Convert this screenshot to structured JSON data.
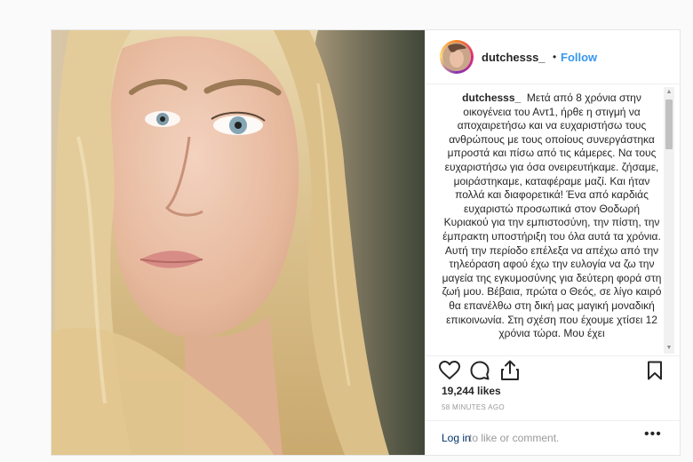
{
  "post": {
    "username": "dutchesss_",
    "separator": "•",
    "follow_label": "Follow",
    "caption_username": "dutchesss_",
    "caption_text": "Μετά από 8 χρόνια στην οικογένεια του Αντ1, ήρθε η στιγμή να αποχαιρετήσω και να ευχαριστήσω τους ανθρώπους με τους οποίους συνεργάστηκα μπροστά και πίσω από τις κάμερες. Να τους ευχαριστήσω για όσα ονειρευτήκαμε. ζήσαμε, μοιράστηκαμε, καταφέραμε μαζί. Και ήταν πολλά και διαφορετικά! Ένα από καρδιάς ευχαριστώ προσωπικά στον Θοδωρή Κυριακού για την εμπιστοσύνη, την πίστη, την έμπρακτη υποστήριξη του όλα αυτά τα χρόνια. Αυτή την περίοδο επέλεξα να απέχω από την τηλεόραση αφού έχω την ευλογία να ζω την μαγεία της εγκυμοσύνης για δεύτερη φορά στη ζωή μου. Βέβαια, πρώτα ο Θεός, σε λίγο καιρό θα επανέλθω στη δική μας μαγική μοναδική επικοινωνία. Στη σχέση που έχουμε χτίσει 12 χρόνια τώρα. Μου έχει",
    "likes": "19,244 likes",
    "timestamp": "58 MINUTES AGO",
    "login_link": "Log in",
    "login_rest": "to like or comment.",
    "more_label": "•••"
  },
  "icons": {
    "like": "heart-icon",
    "comment": "comment-icon",
    "share": "share-icon",
    "save": "bookmark-icon"
  },
  "colors": {
    "link_blue": "#3897f0",
    "text": "#262626",
    "muted": "#999999",
    "border": "#efefef"
  }
}
